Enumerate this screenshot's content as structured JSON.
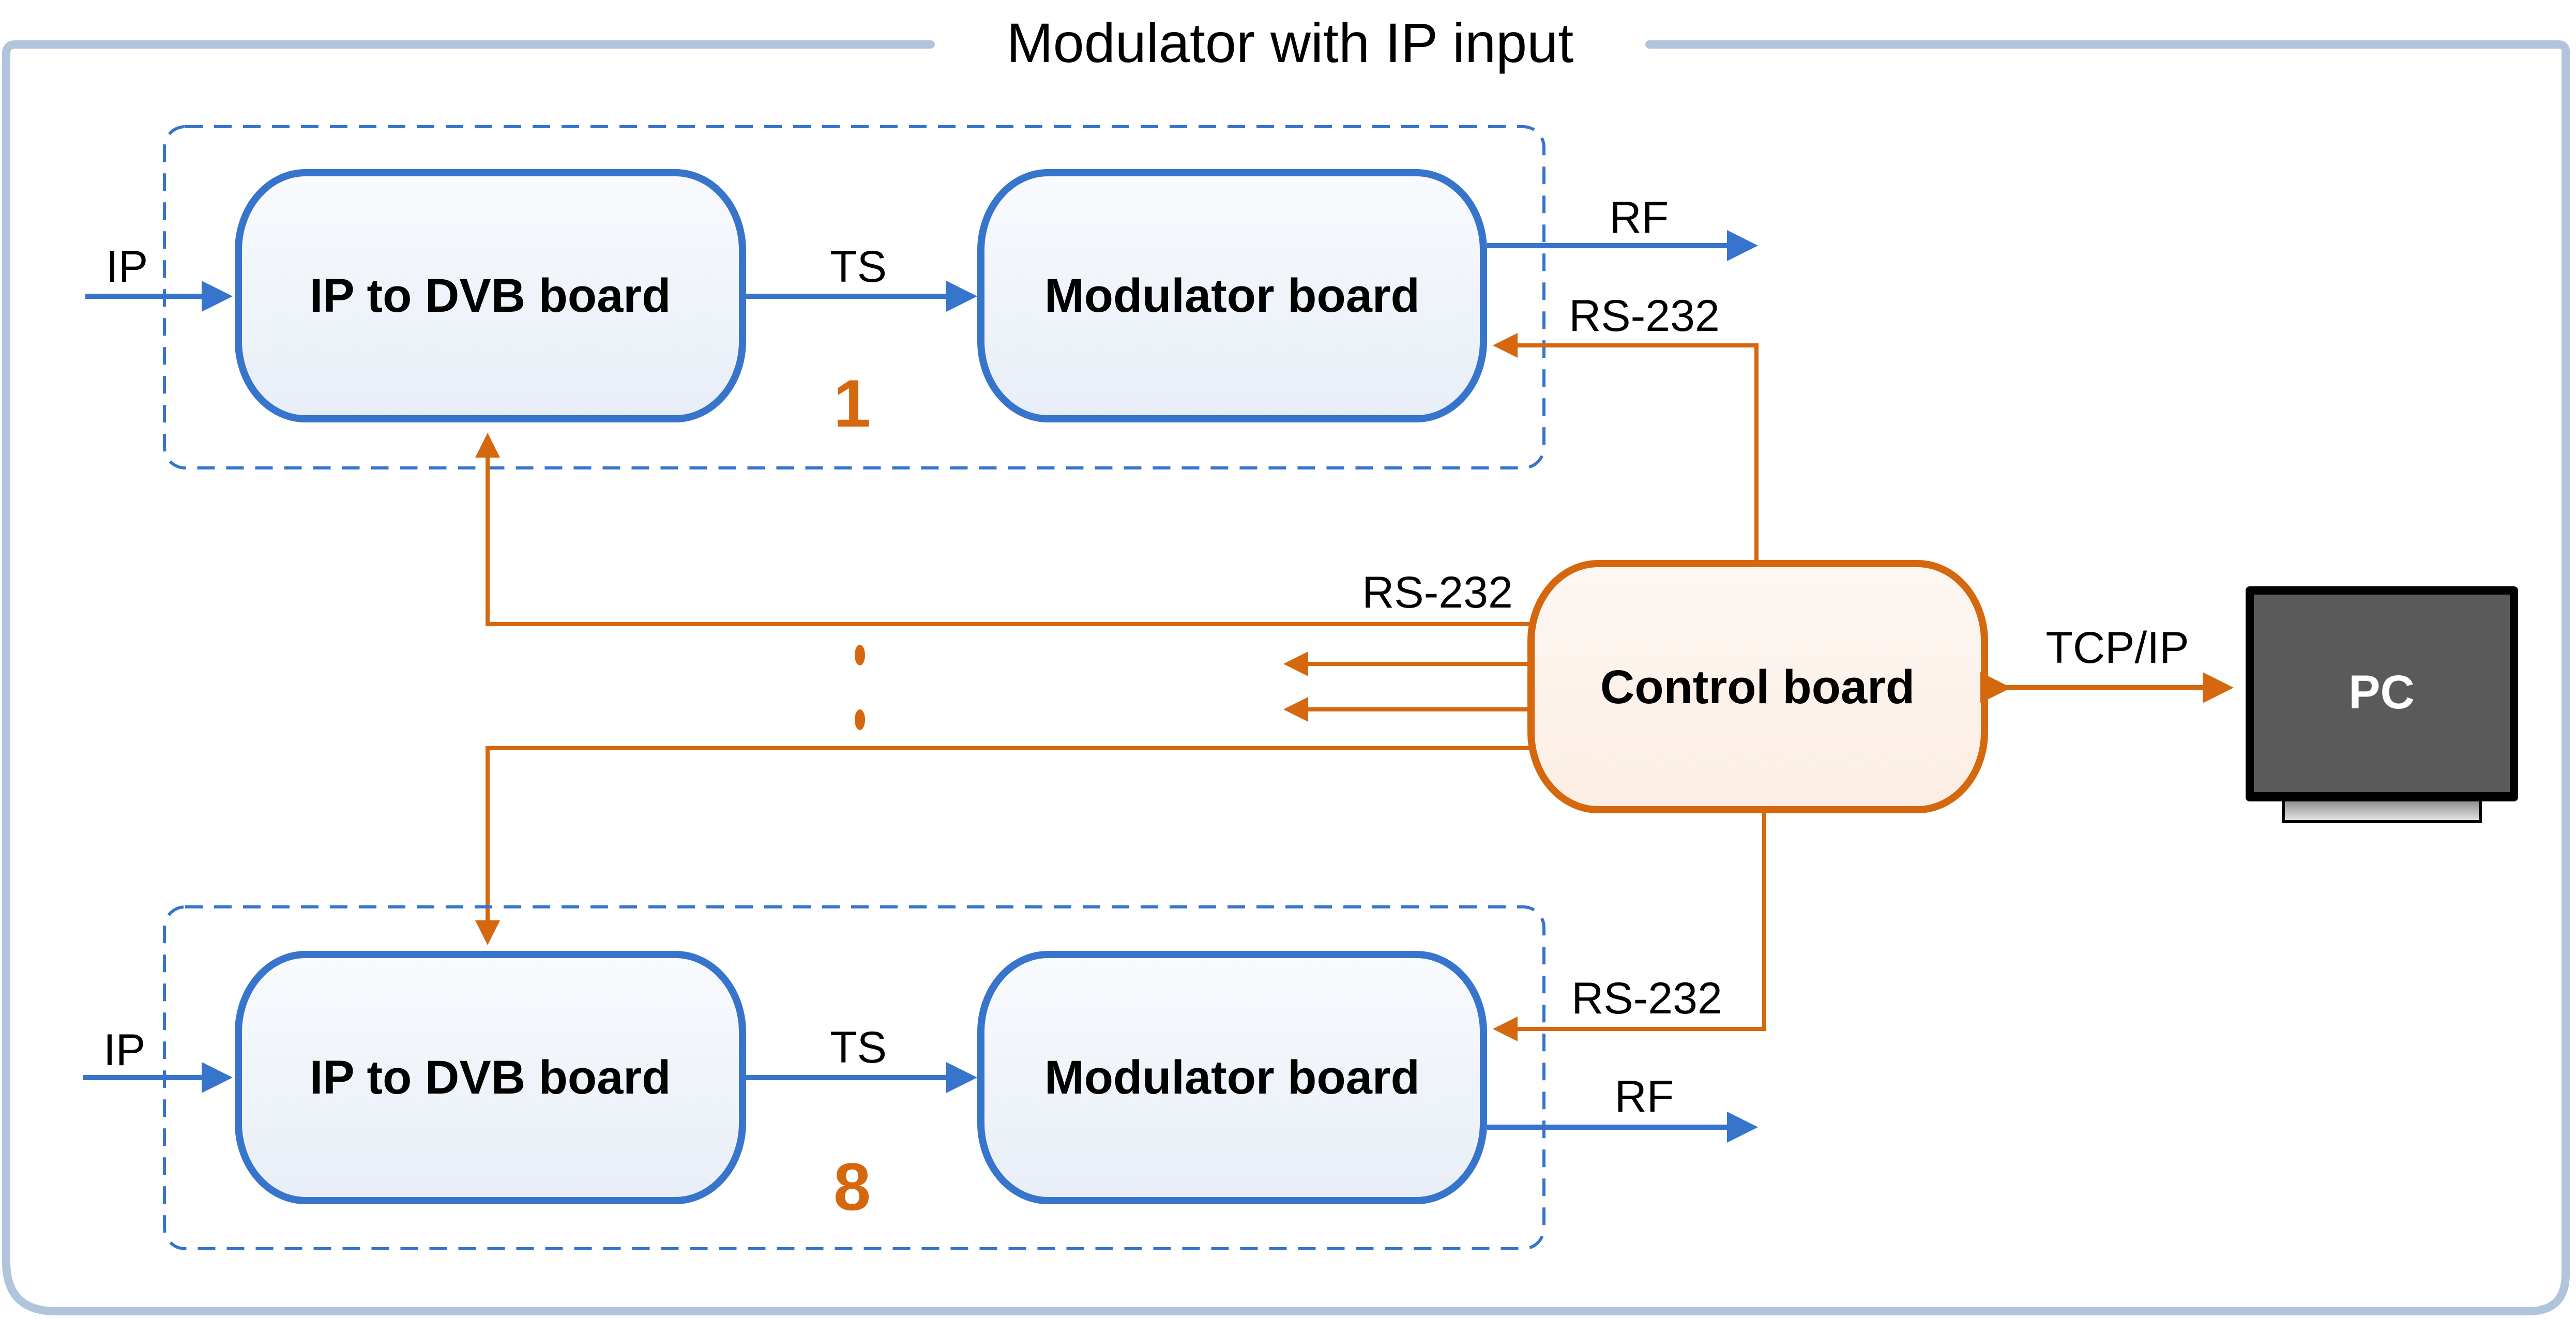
{
  "title": "Modulator with IP input",
  "colors": {
    "frame": "#b0c4dc",
    "blue": "#3775cc",
    "orange": "#d5680f",
    "box_fill_top": "#f8fafd",
    "box_fill_bottom": "#e8eef7",
    "control_fill": "#fcf3ec",
    "pc_screen": "#5a5a5a"
  },
  "groups": [
    {
      "index_label": "1",
      "ip_to_dvb_label": "IP to DVB board",
      "modulator_label": "Modulator board",
      "input_label": "IP",
      "link_label": "TS",
      "output_label": "RF",
      "control_label": "RS-232"
    },
    {
      "index_label": "8",
      "ip_to_dvb_label": "IP to DVB board",
      "modulator_label": "Modulator board",
      "input_label": "IP",
      "link_label": "TS",
      "output_label": "RF",
      "control_label": "RS-232"
    }
  ],
  "control_board": {
    "label": "Control board",
    "bus_label": "RS-232"
  },
  "pc": {
    "label": "PC",
    "link_label": "TCP/IP"
  }
}
